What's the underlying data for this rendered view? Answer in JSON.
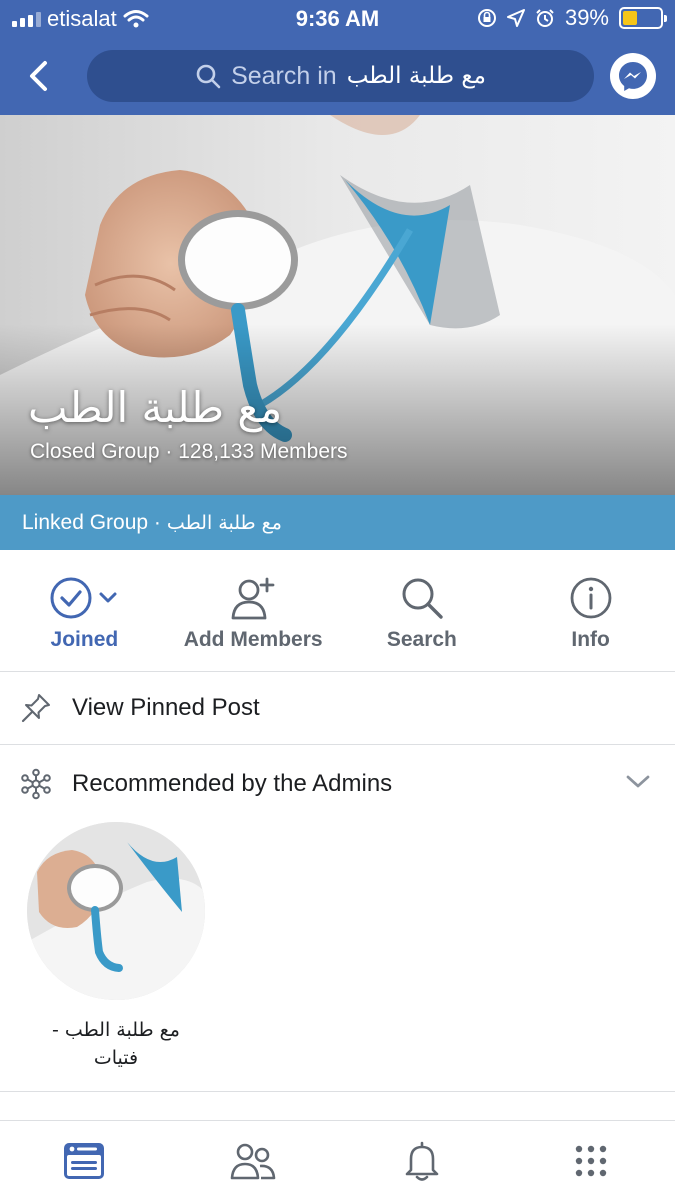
{
  "status_bar": {
    "carrier": "etisalat",
    "time": "9:36 AM",
    "battery_percent": "39%",
    "battery_level": 0.39
  },
  "nav": {
    "search_prefix": "Search in",
    "search_query": "مع طلبة الطب"
  },
  "cover": {
    "group_name": "مع طلبة الطب",
    "subtitle": "Closed Group · 128,133 Members"
  },
  "linked": {
    "prefix": "Linked Group ·",
    "name": "مع طلبة الطب"
  },
  "actions": {
    "joined": "Joined",
    "add_members": "Add Members",
    "search": "Search",
    "info": "Info"
  },
  "pinned": {
    "label": "View Pinned Post"
  },
  "recommended": {
    "label": "Recommended by the Admins",
    "items": [
      {
        "line1": "مع طلبة الطب -",
        "line2": "فتيات"
      }
    ]
  },
  "colors": {
    "brand": "#4267b2",
    "linked_bar": "#4e9ac7",
    "text": "#1c1e21",
    "secondary": "#606770"
  }
}
